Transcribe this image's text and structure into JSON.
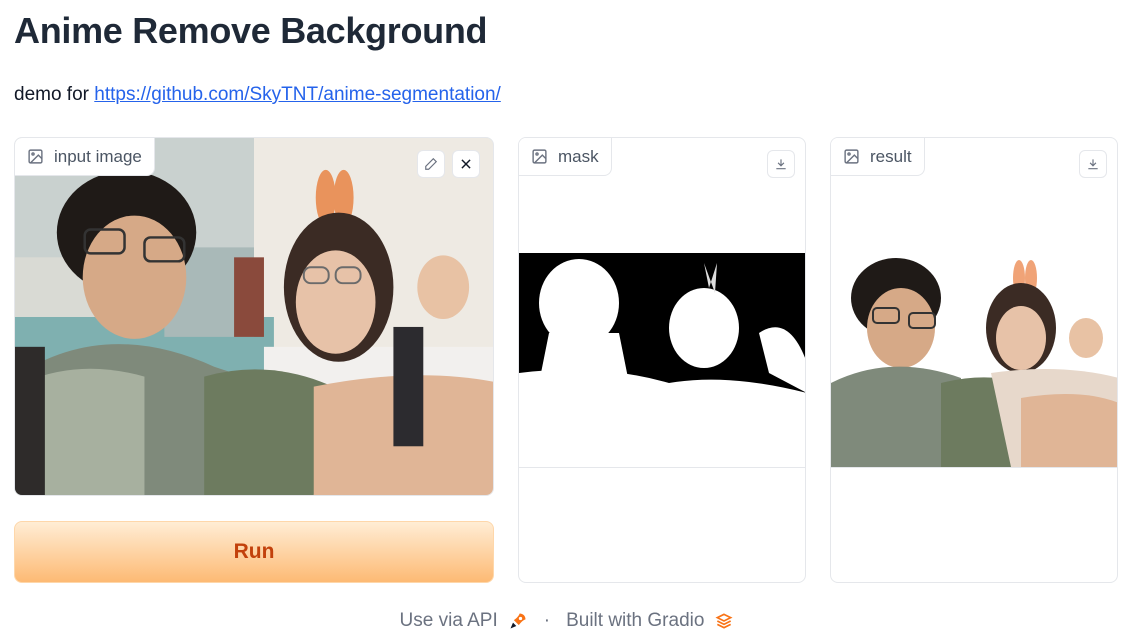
{
  "header": {
    "title": "Anime Remove Background",
    "description_prefix": "demo for ",
    "description_link": "https://github.com/SkyTNT/anime-segmentation/"
  },
  "input_panel": {
    "label": "input image",
    "label_icon": "image-icon",
    "edit_icon": "pencil-icon",
    "clear_icon": "close-icon"
  },
  "mask_panel": {
    "label": "mask",
    "label_icon": "image-icon",
    "download_icon": "download-icon"
  },
  "result_panel": {
    "label": "result",
    "label_icon": "image-icon",
    "download_icon": "download-icon"
  },
  "run_button": {
    "label": "Run"
  },
  "footer": {
    "api_label": "Use via API",
    "separator": "·",
    "built_label": "Built with Gradio"
  },
  "colors": {
    "accent": "#c2410c",
    "button_gradient_top": "#ffedd5",
    "button_gradient_bottom": "#fdba74",
    "link": "#2563eb"
  }
}
